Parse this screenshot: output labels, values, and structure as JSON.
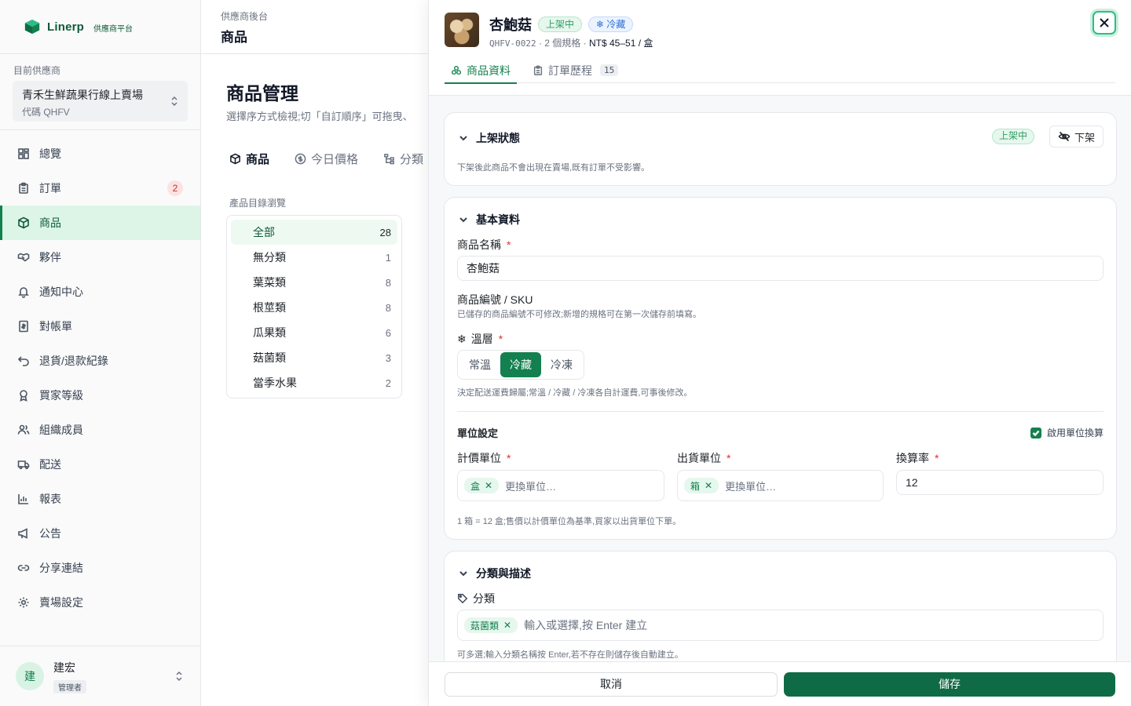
{
  "brand": {
    "name": "Linerp",
    "subtitle": "供應商平台"
  },
  "vendor": {
    "label": "目前供應商",
    "name": "青禾生鮮蔬果行線上賣場",
    "code": "代碼 QHFV"
  },
  "nav": [
    {
      "label": "總覽",
      "icon": "grid-icon"
    },
    {
      "label": "訂單",
      "icon": "clipboard-icon",
      "badge": "2"
    },
    {
      "label": "商品",
      "icon": "box-icon",
      "active": true
    },
    {
      "label": "夥伴",
      "icon": "handshake-icon"
    },
    {
      "label": "通知中心",
      "icon": "bell-icon"
    },
    {
      "label": "對帳單",
      "icon": "invoice-icon"
    },
    {
      "label": "退貨/退款紀錄",
      "icon": "undo-icon"
    },
    {
      "label": "買家等級",
      "icon": "award-icon"
    },
    {
      "label": "組織成員",
      "icon": "users-icon"
    },
    {
      "label": "配送",
      "icon": "truck-icon"
    },
    {
      "label": "報表",
      "icon": "bar-chart-icon"
    },
    {
      "label": "公告",
      "icon": "megaphone-icon"
    },
    {
      "label": "分享連結",
      "icon": "link-icon"
    },
    {
      "label": "賣場設定",
      "icon": "gear-icon"
    }
  ],
  "user": {
    "initial": "建",
    "name": "建宏",
    "role": "管理者"
  },
  "main": {
    "breadcrumb": "供應商後台",
    "header_title": "商品",
    "page_title": "商品管理",
    "page_desc": "選擇序方式檢視;切「自訂順序」可拖曳、",
    "tabs": [
      {
        "label": "商品",
        "icon": "box-icon",
        "active": true
      },
      {
        "label": "今日價格",
        "icon": "dollar-icon"
      },
      {
        "label": "分類",
        "icon": "tree-icon"
      }
    ],
    "category_label": "產品目錄瀏覽",
    "categories": [
      {
        "name": "全部",
        "count": "28",
        "active": true
      },
      {
        "name": "無分類",
        "count": "1"
      },
      {
        "name": "葉菜類",
        "count": "8"
      },
      {
        "name": "根莖類",
        "count": "8"
      },
      {
        "name": "瓜果類",
        "count": "6"
      },
      {
        "name": "菇菌類",
        "count": "3"
      },
      {
        "name": "當季水果",
        "count": "2"
      }
    ]
  },
  "drawer": {
    "product_name": "杏鮑菇",
    "status_pill": "上架中",
    "temp_pill": "冷藏",
    "sku": "QHFV-0022",
    "sep1": "·",
    "spec_count": "2 個規格",
    "sep2": "·",
    "price": "NT$ 45–51 / 盒",
    "tabs": [
      {
        "label": "商品資料",
        "icon": "boxes-icon",
        "active": true
      },
      {
        "label": "訂單歷程",
        "icon": "clipboard-icon",
        "count": "15"
      }
    ],
    "status_section": {
      "title": "上架狀態",
      "badge": "上架中",
      "action": "下架",
      "help": "下架後此商品不會出現在賣場,既有訂單不受影響。"
    },
    "basic": {
      "title": "基本資料",
      "name_label": "商品名稱",
      "name_value": "杏鮑菇",
      "sku_label": "商品編號 / SKU",
      "sku_help": "已儲存的商品編號不可修改;新增的規格可在第一次儲存前填寫。",
      "temp_label": "溫層",
      "temp_options": [
        "常溫",
        "冷藏",
        "冷凍"
      ],
      "temp_selected": "冷藏",
      "temp_help": "決定配送運費歸屬;常溫 / 冷藏 / 冷凍各自計運費,可事後修改。",
      "unit_title": "單位設定",
      "unit_toggle": "啟用單位換算",
      "price_unit_label": "計價單位",
      "price_unit_chip": "盒",
      "price_unit_placeholder": "更換單位…",
      "ship_unit_label": "出貨單位",
      "ship_unit_chip": "箱",
      "ship_unit_placeholder": "更換單位…",
      "ratio_label": "換算率",
      "ratio_value": "12",
      "unit_help": "1 箱 = 12 盒;售價以計價單位為基準,買家以出貨單位下單。"
    },
    "category_section": {
      "title": "分類與描述",
      "label": "分類",
      "chip": "菇菌類",
      "placeholder": "輸入或選擇,按 Enter 建立",
      "help": "可多選;輸入分類名稱按 Enter,若不存在則儲存後自動建立。"
    },
    "cancel": "取消",
    "save": "儲存"
  },
  "colors": {
    "brand": "#0f5b3a",
    "accent": "#14804f",
    "save": "#0f6b45"
  }
}
